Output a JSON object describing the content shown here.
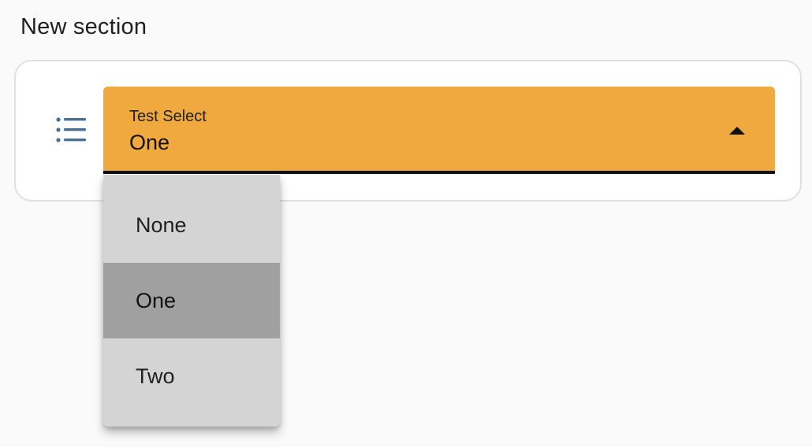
{
  "section": {
    "title": "New section"
  },
  "field": {
    "icon": "list-icon",
    "select": {
      "label": "Test Select",
      "value": "One",
      "background_color": "#f0a93f",
      "expanded": true
    }
  },
  "dropdown": {
    "options": [
      "None",
      "One",
      "Two"
    ],
    "selected_index": 1
  }
}
